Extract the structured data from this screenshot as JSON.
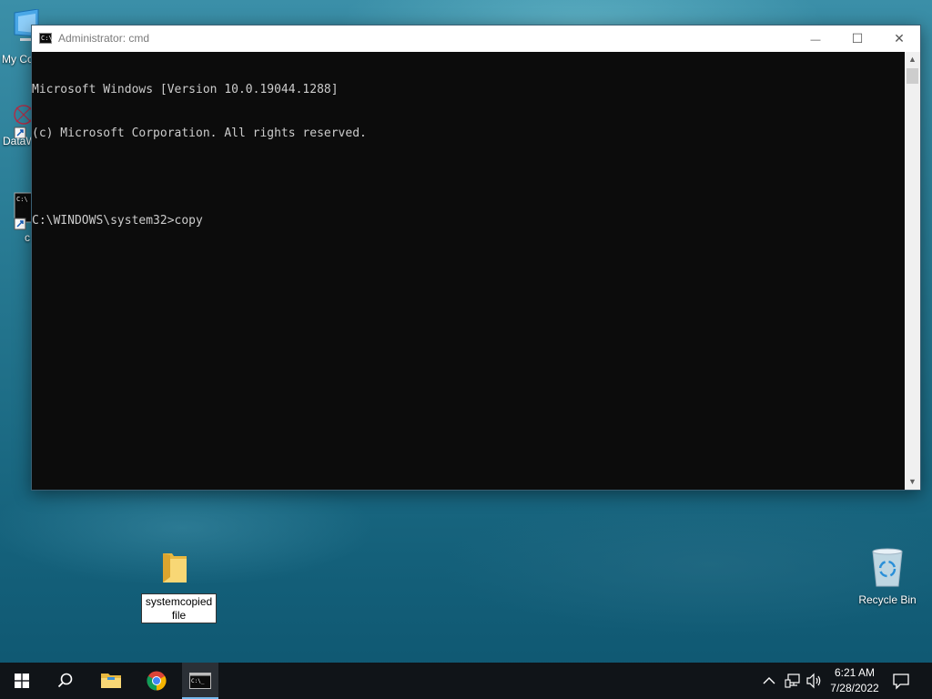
{
  "desktop": {
    "icons": [
      {
        "label": "My Co"
      },
      {
        "label": "DataW"
      },
      {
        "label": "c"
      }
    ],
    "folder": {
      "label_line1": "systemcopied",
      "label_line2": "file"
    },
    "recycle_bin": {
      "label": "Recycle Bin"
    }
  },
  "window": {
    "title": "Administrator: cmd",
    "minimize_glyph": "—",
    "maximize_glyph": "☐",
    "close_glyph": "✕",
    "console_lines": [
      "Microsoft Windows [Version 10.0.19044.1288]",
      "(c) Microsoft Corporation. All rights reserved.",
      "",
      "C:\\WINDOWS\\system32>copy"
    ]
  },
  "taskbar": {
    "items": [
      {
        "icon": "windows-start-icon"
      },
      {
        "icon": "search-icon"
      },
      {
        "icon": "file-explorer-icon"
      },
      {
        "icon": "chrome-icon"
      },
      {
        "icon": "cmd-icon",
        "active": true
      }
    ],
    "tray": {
      "time": "6:21 AM",
      "date": "7/28/2022"
    }
  },
  "colors": {
    "console_bg": "#0c0c0c",
    "console_text": "#cccccc",
    "taskbar_bg": "#101418",
    "active_indicator": "#76b9ed"
  }
}
